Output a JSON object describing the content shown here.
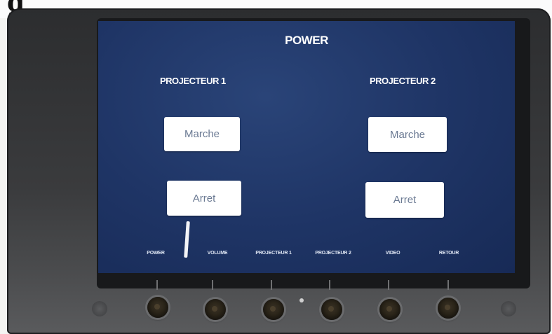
{
  "top_strip_text": "g",
  "screen": {
    "title": "POWER",
    "columns": [
      {
        "heading": "PROJECTEUR 1",
        "on_label": "Marche",
        "off_label": "Arret"
      },
      {
        "heading": "PROJECTEUR 2",
        "on_label": "Marche",
        "off_label": "Arret"
      }
    ]
  },
  "nav": {
    "items": [
      "POWER",
      "VOLUME",
      "PROJECTEUR 1",
      "PROJECTEUR 2",
      "VIDEO",
      "RETOUR"
    ]
  },
  "colors": {
    "screen_background": "#1f3566",
    "button_background": "#ffffff",
    "button_text": "#6b7a93",
    "bezel": "#2c2d2f"
  }
}
